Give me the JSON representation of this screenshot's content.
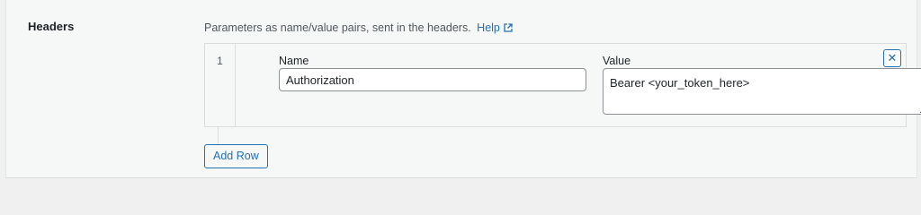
{
  "field": {
    "label": "Headers",
    "description": "Parameters as name/value pairs, sent in the headers.",
    "help_link": "Help",
    "help_icon": "external-link-icon"
  },
  "repeater": {
    "columns": {
      "name_label": "Name",
      "value_label": "Value"
    },
    "rows": [
      {
        "index": "1",
        "name": "Authorization",
        "value": "Bearer <your_token_here>"
      }
    ],
    "remove_button": "✕",
    "add_row_label": "Add Row"
  },
  "colors": {
    "accent": "#2271b1",
    "border": "#dcdcde",
    "background": "#f6f7f7"
  }
}
